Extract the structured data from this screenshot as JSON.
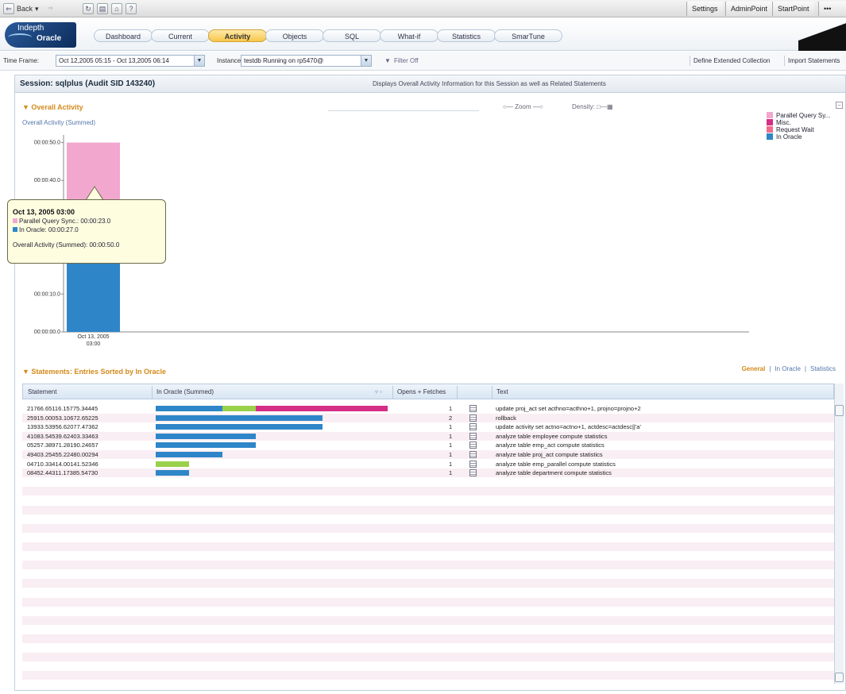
{
  "toolbar": {
    "back_label": "Back",
    "settings_label": "Settings",
    "adminpoint_label": "AdminPoint",
    "startpoint_label": "StartPoint"
  },
  "header": {
    "logo_line1": "Indepth",
    "logo_line2": "Oracle",
    "tabs": [
      {
        "label": "Dashboard"
      },
      {
        "label": "Current"
      },
      {
        "label": "Activity"
      },
      {
        "label": "Objects"
      },
      {
        "label": "SQL"
      },
      {
        "label": "What-if"
      },
      {
        "label": "Statistics"
      },
      {
        "label": "SmarTune"
      }
    ],
    "active_tab": "Activity"
  },
  "filter": {
    "timeframe_label": "Time Frame:",
    "timeframe_value": "Oct 12,2005 05:15 - Oct 13,2005 06:14",
    "instance_label": "Instance:",
    "instance_value": "testdb Running on rp5470@",
    "filter_label": "Filter Off",
    "define_label": "Define Extended Collection",
    "import_label": "Import Statements"
  },
  "session": {
    "title": "Session: sqlplus (Audit SID 143240)",
    "description": "Displays Overall Activity Information for this Session as well as Related Statements"
  },
  "overall": {
    "section_title": "Overall Activity",
    "chart_label": "Overall Activity (Summed)",
    "zoom_label": "Zoom",
    "density_label": "Density:"
  },
  "chart_data": {
    "type": "bar",
    "stacked": true,
    "categories": [
      "Oct 13, 2005 03:00"
    ],
    "series": [
      {
        "name": "In Oracle",
        "values": [
          27.0
        ],
        "color": "#2e86c8"
      },
      {
        "name": "Parallel Query Sy...",
        "values": [
          23.0
        ],
        "color": "#f2a7cf"
      }
    ],
    "y_ticks": [
      "00:00:00.0",
      "00:00:10.0",
      "00:00:40.0",
      "00:00:50.0"
    ],
    "ylim": [
      0,
      52
    ],
    "grid": false,
    "legend_position": "top-right"
  },
  "legend": [
    {
      "name": "Parallel Query Sy...",
      "color": "#f2a7cf"
    },
    {
      "name": "Misc.",
      "color": "#d42e86"
    },
    {
      "name": "Request Wait",
      "color": "#f06c8a"
    },
    {
      "name": "In Oracle",
      "color": "#2e86c8"
    }
  ],
  "tooltip": {
    "title": "Oct 13, 2005 03:00",
    "line1": "Parallel Query Sync.: 00:00:23.0",
    "line2": "In Oracle: 00:00:27.0",
    "summary": "Overall Activity (Summed): 00:00:50.0"
  },
  "x_tick_label_1": "Oct 13, 2005",
  "x_tick_label_2": "03:00",
  "statements": {
    "section_title": "Statements: Entries Sorted by In Oracle",
    "view_tabs": [
      "General",
      "In Oracle",
      "Statistics"
    ],
    "columns": [
      "Statement",
      "In Oracle (Summed)",
      "Opens + Fetches",
      "Text"
    ],
    "rows": [
      {
        "id": "21766.65116.15775.34445",
        "opens": "1",
        "text": "update proj_act set acthno=acthno+1, projno=projno+2",
        "bars": [
          {
            "c": "#2e86c8",
            "v": 0.48
          },
          {
            "c": "#9ad14a",
            "v": 0.24
          },
          {
            "c": "#d42e86",
            "v": 0.95
          }
        ]
      },
      {
        "id": "25915.00053.10672.65225",
        "opens": "2",
        "text": "rollback",
        "bars": [
          {
            "c": "#2e86c8",
            "v": 1.2
          }
        ]
      },
      {
        "id": "13933.53956.62077.47362",
        "opens": "1",
        "text": "update activity set actno=actno+1, actdesc=actdesc||'a'",
        "bars": [
          {
            "c": "#2e86c8",
            "v": 1.2
          }
        ]
      },
      {
        "id": "41083.54539.62403.33463",
        "opens": "1",
        "text": "analyze table employee compute statistics",
        "bars": [
          {
            "c": "#2e86c8",
            "v": 0.72
          }
        ]
      },
      {
        "id": "05257.38971.28190.24657",
        "opens": "1",
        "text": "analyze table emp_act compute statistics",
        "bars": [
          {
            "c": "#2e86c8",
            "v": 0.72
          }
        ]
      },
      {
        "id": "49403.25455.22480.00294",
        "opens": "1",
        "text": "analyze table proj_act compute statistics",
        "bars": [
          {
            "c": "#2e86c8",
            "v": 0.48
          }
        ]
      },
      {
        "id": "04710.33414.00141.52346",
        "opens": "1",
        "text": "analyze table emp_parallel compute statistics",
        "bars": [
          {
            "c": "#9ad14a",
            "v": 0.24
          }
        ]
      },
      {
        "id": "08452.44311.17385.54730",
        "opens": "1",
        "text": "analyze table department compute statistics",
        "bars": [
          {
            "c": "#2e86c8",
            "v": 0.24
          }
        ]
      }
    ]
  }
}
